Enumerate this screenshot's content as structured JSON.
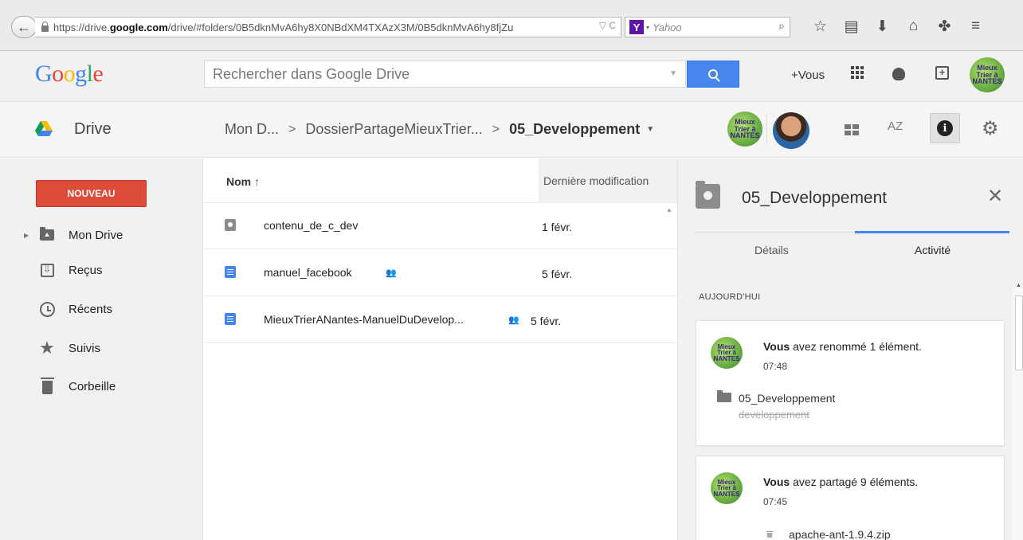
{
  "browser": {
    "url_prefix": "https://drive.",
    "url_domain": "google.com",
    "url_rest": "/drive/#folders/0B5dknMvA6hy8X0NBdXM4TXAzX3M/0B5dknMvA6hy8fjZu",
    "url_tail": "▽ C",
    "search_engine": "Yahoo",
    "search_engine_logo": "Y"
  },
  "google_bar": {
    "logo_letters": [
      {
        "char": "G",
        "color": "#4285f4"
      },
      {
        "char": "o",
        "color": "#ea4335"
      },
      {
        "char": "o",
        "color": "#fbbc05"
      },
      {
        "char": "g",
        "color": "#4285f4"
      },
      {
        "char": "l",
        "color": "#34a853"
      },
      {
        "char": "e",
        "color": "#ea4335"
      }
    ],
    "search_placeholder": "Rechercher dans Google Drive",
    "plus_you": "+Vous",
    "share_symbol": "+"
  },
  "brand_logo": {
    "line1": "Mieux",
    "line2": "Trier à",
    "line3": "NANTES"
  },
  "drive_bar": {
    "app_name": "Drive",
    "breadcrumb": [
      {
        "label": "Mon D..."
      },
      {
        "label": "DossierPartageMieuxTrier..."
      }
    ],
    "current_folder": "05_Developpement",
    "sort_icon_text": "AZ",
    "info_symbol": "i"
  },
  "sidebar": {
    "new_button": "NOUVEAU",
    "items": [
      {
        "label": "Mon Drive",
        "icon": "my-drive-icon"
      },
      {
        "label": "Reçus",
        "icon": "incoming-icon"
      },
      {
        "label": "Récents",
        "icon": "clock-icon"
      },
      {
        "label": "Suivis",
        "icon": "star-icon"
      },
      {
        "label": "Corbeille",
        "icon": "trash-icon"
      }
    ]
  },
  "file_list": {
    "col_name": "Nom",
    "sort_arrow": "↑",
    "col_modified": "Dernière modification",
    "files": [
      {
        "name": "contenu_de_c_dev",
        "type": "shared-folder",
        "shared": false,
        "modified": "1 févr."
      },
      {
        "name": "manuel_facebook",
        "type": "document",
        "shared": true,
        "modified": "5 févr."
      },
      {
        "name": "MieuxTrierANantes-ManuelDuDevelop...",
        "type": "document",
        "shared": true,
        "modified": "5 févr."
      }
    ]
  },
  "details_panel": {
    "title": "05_Developpement",
    "tabs": [
      {
        "label": "Détails",
        "active": false
      },
      {
        "label": "Activité",
        "active": true
      }
    ],
    "section_label": "AUJOURD'HUI",
    "activities": [
      {
        "actor": "Vous",
        "action": " avez renommé 1 élément.",
        "time": "07:48",
        "new_name": "05_Developpement",
        "old_name": "developpement"
      },
      {
        "actor": "Vous",
        "action": " avez partagé 9 éléments.",
        "time": "07:45",
        "item_name": "apache-ant-1.9.4.zip"
      }
    ]
  },
  "colors": {
    "accent_blue": "#4285f4",
    "new_button_red": "#dd4b39",
    "search_button_blue": "#4787ed"
  }
}
